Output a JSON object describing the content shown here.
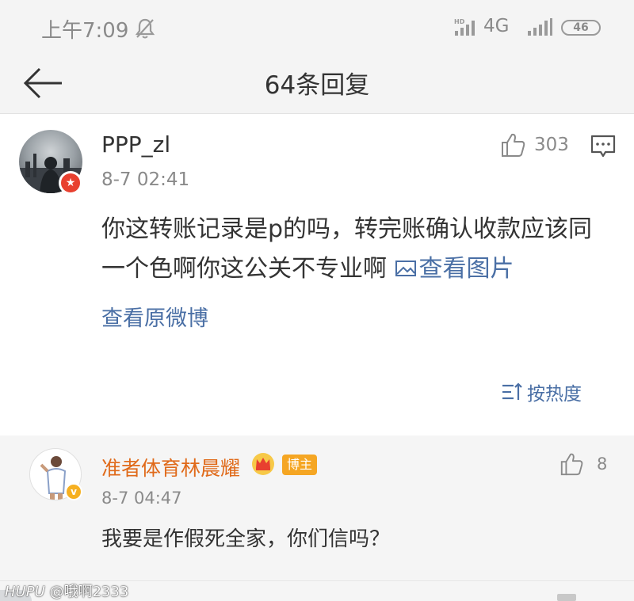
{
  "status_bar": {
    "time": "上午7:09",
    "network": "4G",
    "battery": "46",
    "icons": [
      "mute-bell-icon",
      "hd-signal-icon",
      "signal-icon",
      "battery-icon"
    ]
  },
  "nav": {
    "title": "64条回复",
    "back_icon": "arrow-left-icon"
  },
  "main_comment": {
    "username": "PPP_zl",
    "timestamp": "8-7 02:41",
    "likes": "303",
    "text": "你这转账记录是p的吗，转完账确认收款应该同一个色啊你这公关不专业啊",
    "view_image_label": "查看图片",
    "view_original_label": "查看原微博",
    "sort_label": "按热度"
  },
  "reply": {
    "username": "准者体育林晨耀",
    "badge": "博主",
    "timestamp": "8-7 04:47",
    "likes": "8",
    "text": "我要是作假死全家，你们信吗？"
  },
  "watermark": {
    "brand": "HUPU",
    "user": "@哦啊2333"
  },
  "colors": {
    "link": "#4a6fa5",
    "reply_username": "#e06a1a",
    "badge": "#f5a623",
    "avatar_badge": "#e8402f"
  }
}
